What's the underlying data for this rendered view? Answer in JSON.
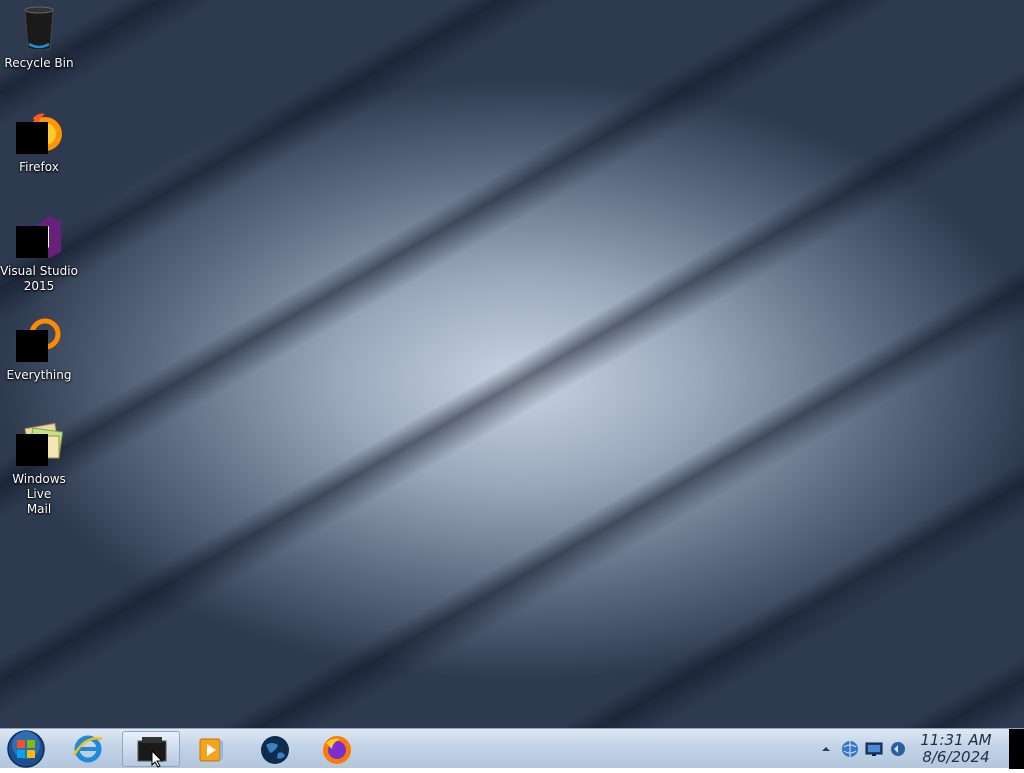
{
  "desktop": {
    "icons": [
      {
        "name": "recycle-bin",
        "label": "Recycle Bin"
      },
      {
        "name": "firefox",
        "label": "Firefox"
      },
      {
        "name": "visual-studio-2015",
        "label_line1": "Visual Studio",
        "label_line2": "2015"
      },
      {
        "name": "everything",
        "label": "Everything"
      },
      {
        "name": "windows-live-mail",
        "label_line1": "Windows Live",
        "label_line2": "Mail"
      }
    ]
  },
  "taskbar": {
    "pinned": [
      {
        "name": "start-orb-icon"
      },
      {
        "name": "internet-explorer-icon"
      },
      {
        "name": "program-icon",
        "active": true
      },
      {
        "name": "media-player-icon"
      },
      {
        "name": "globe-icon"
      },
      {
        "name": "firefox-icon"
      }
    ],
    "tray": {
      "icons": [
        "tray-overflow-arrow-icon",
        "network-globe-icon",
        "monitor-icon",
        "volume-icon"
      ],
      "time": "11:31 AM",
      "date": "8/6/2024"
    }
  },
  "colors": {
    "taskbar_top": "#dfe8f3",
    "taskbar_bottom": "#b3c6dd",
    "clock_text": "#1f2d45"
  }
}
